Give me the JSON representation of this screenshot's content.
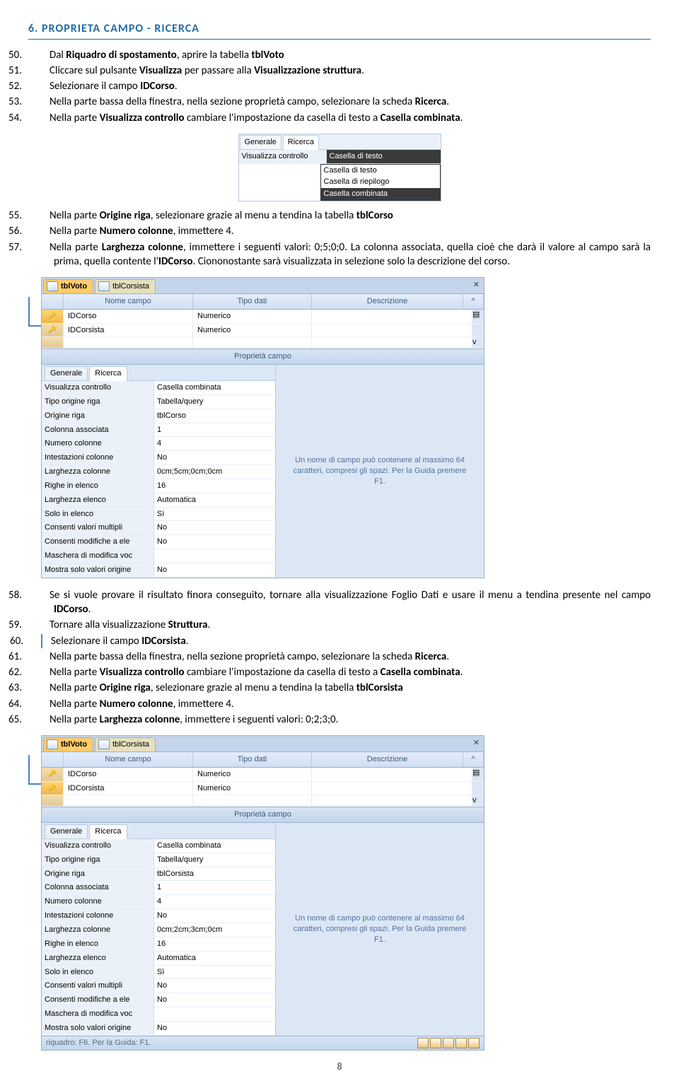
{
  "section_title": "6.  PROPRIETA CAMPO - RICERCA",
  "steps1": {
    "50": {
      "t": "Dal ",
      "b1": "Riquadro di spostamento",
      "t2": ", aprire la tabella ",
      "b2": "tblVoto"
    },
    "51": {
      "t": "Cliccare sul pulsante ",
      "b1": "Visualizza",
      "t2": " per passare alla ",
      "b2": "Visualizzazione struttura",
      "t3": "."
    },
    "52": {
      "t": "Selezionare  il campo ",
      "b1": "IDCorso",
      "t2": "."
    },
    "53": {
      "t": "Nella parte bassa della finestra, nella sezione proprietà campo, selezionare la scheda ",
      "b1": "Ricerca",
      "t2": "."
    },
    "54": {
      "t": "Nella parte ",
      "b1": "Visualizza controllo",
      "t2": " cambiare l'impostazione da casella di testo a ",
      "b2": "Casella combinata",
      "t3": "."
    }
  },
  "popup": {
    "tab_gen": "Generale",
    "tab_ric": "Ricerca",
    "label": "Visualizza controllo",
    "value": "Casella di testo",
    "options": [
      "Casella di testo",
      "Casella di riepilogo",
      "Casella combinata"
    ]
  },
  "steps2": {
    "55": {
      "t": "Nella parte ",
      "b1": "Origine riga",
      "t2": ", selezionare grazie al menu a tendina la tabella ",
      "b2": "tblCorso"
    },
    "56": {
      "t": "Nella parte ",
      "b1": "Numero colonne",
      "t2": ", immettere 4."
    },
    "57": {
      "t": "Nella parte ",
      "b1": "Larghezza colonne",
      "t2": ", immettere i seguenti valori: 0;5;0;0. La colonna associata, quella cioè che darà il valore al campo sarà la prima, quella contente l'",
      "b2": "IDCorso",
      "t3": ". Ciononostante sarà visualizzata in selezione solo la descrizione del corso."
    }
  },
  "panel1": {
    "tab1": "tblVoto",
    "tab2": "tblCorsista",
    "headers": {
      "name": "Nome campo",
      "type": "Tipo dati",
      "desc": "Descrizione"
    },
    "rows": [
      {
        "pk": true,
        "name": "IDCorso",
        "type": "Numerico"
      },
      {
        "pk": false,
        "name": "IDCorsista",
        "type": "Numerico"
      }
    ],
    "section_label": "Proprietà campo",
    "ps_tab_gen": "Generale",
    "ps_tab_ric": "Ricerca",
    "props": [
      {
        "l": "Visualizza controllo",
        "v": "Casella combinata"
      },
      {
        "l": "Tipo origine riga",
        "v": "Tabella/query"
      },
      {
        "l": "Origine riga",
        "v": "tblCorso"
      },
      {
        "l": "Colonna associata",
        "v": "1"
      },
      {
        "l": "Numero colonne",
        "v": "4"
      },
      {
        "l": "Intestazioni colonne",
        "v": "No"
      },
      {
        "l": "Larghezza colonne",
        "v": "0cm;5cm;0cm;0cm"
      },
      {
        "l": "Righe in elenco",
        "v": "16"
      },
      {
        "l": "Larghezza elenco",
        "v": "Automatica"
      },
      {
        "l": "Solo in elenco",
        "v": "Sì"
      },
      {
        "l": "Consenti valori multipli",
        "v": "No"
      },
      {
        "l": "Consenti modifiche a ele",
        "v": "No"
      },
      {
        "l": "Maschera di modifica voc",
        "v": ""
      },
      {
        "l": "Mostra solo valori origine",
        "v": "No"
      }
    ],
    "help": "Un nome di campo può contenere al massimo 64 caratteri, compresi gli spazi. Per la Guida premere F1."
  },
  "steps3": {
    "58": "Se si vuole provare il risultato finora conseguito, tornare alla visualizzazione Foglio Dati e usare il menu a tendina presente nel campo ",
    "58b": "IDCorso",
    "58c": ".",
    "59": {
      "t": "Tornare alla visualizzazione ",
      "b1": "Struttura",
      "t2": "."
    },
    "60": {
      "t": "Selezionare il campo ",
      "b1": "IDCorsista",
      "t2": "."
    },
    "61": {
      "t": "Nella parte bassa della finestra, nella sezione proprietà campo, selezionare la scheda ",
      "b1": "Ricerca",
      "t2": "."
    },
    "62": {
      "t": "Nella parte ",
      "b1": "Visualizza controllo",
      "t2": " cambiare l'impostazione da casella di testo a ",
      "b2": "Casella combinata",
      "t3": "."
    },
    "63": {
      "t": "Nella parte ",
      "b1": "Origine riga",
      "t2": ", selezionare grazie al menu a tendina la tabella ",
      "b2": "tblCorsista"
    },
    "64": {
      "t": "Nella parte ",
      "b1": "Numero colonne",
      "t2": ", immettere 4."
    },
    "65": {
      "t": "Nella parte ",
      "b1": "Larghezza colonne",
      "t2": ", immettere i seguenti valori: 0;2;3;0."
    }
  },
  "panel2": {
    "tab1": "tblVoto",
    "tab2": "tblCorsista",
    "headers": {
      "name": "Nome campo",
      "type": "Tipo dati",
      "desc": "Descrizione"
    },
    "rows": [
      {
        "pk": false,
        "name": "IDCorso",
        "type": "Numerico"
      },
      {
        "pk": true,
        "name": "IDCorsista",
        "type": "Numerico"
      }
    ],
    "section_label": "Proprietà campo",
    "ps_tab_gen": "Generale",
    "ps_tab_ric": "Ricerca",
    "props": [
      {
        "l": "Visualizza controllo",
        "v": "Casella combinata"
      },
      {
        "l": "Tipo origine riga",
        "v": "Tabella/query"
      },
      {
        "l": "Origine riga",
        "v": "tblCorsista"
      },
      {
        "l": "Colonna associata",
        "v": "1"
      },
      {
        "l": "Numero colonne",
        "v": "4"
      },
      {
        "l": "Intestazioni colonne",
        "v": "No"
      },
      {
        "l": "Larghezza colonne",
        "v": "0cm;2cm;3cm;0cm"
      },
      {
        "l": "Righe in elenco",
        "v": "16"
      },
      {
        "l": "Larghezza elenco",
        "v": "Automatica"
      },
      {
        "l": "Solo in elenco",
        "v": "Sì"
      },
      {
        "l": "Consenti valori multipli",
        "v": "No"
      },
      {
        "l": "Consenti modifiche a ele",
        "v": "No"
      },
      {
        "l": "Maschera di modifica voc",
        "v": ""
      },
      {
        "l": "Mostra solo valori origine",
        "v": "No"
      }
    ],
    "help": "Un nome di campo può contenere al massimo 64 caratteri, compresi gli spazi. Per la Guida premere F1.",
    "status": "riquadro: F6. Per la Guida: F1."
  },
  "page_num": "8"
}
